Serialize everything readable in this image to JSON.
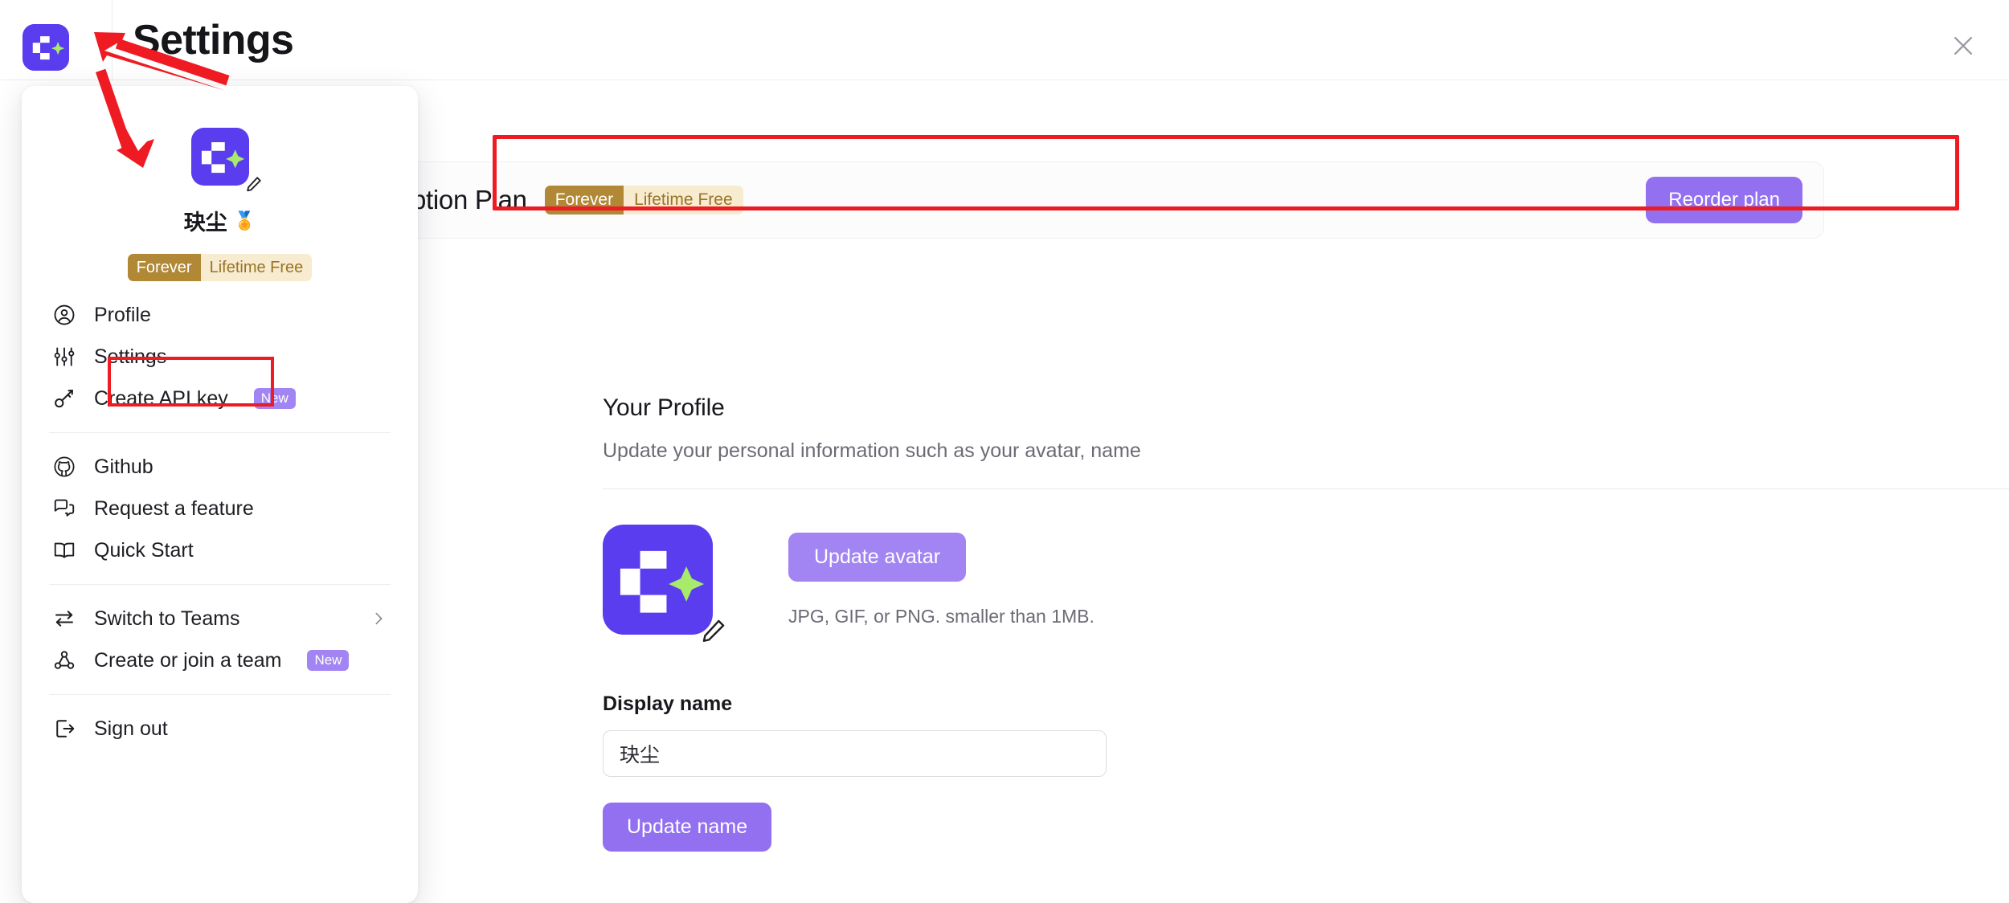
{
  "header": {
    "title": "Settings",
    "logo_icon": "app-logo-icon",
    "close_icon": "close-icon"
  },
  "subscription": {
    "title": "Subscription Plan",
    "plan_tag_left": "Forever",
    "plan_tag_right": "Lifetime Free",
    "reorder_label": "Reorder plan",
    "accent_purple": "#9370f0",
    "gold_dark": "#b08836",
    "gold_light": "#f7ebd0",
    "highlight_color": "#ee1b22"
  },
  "profile": {
    "section_title": "Your Profile",
    "section_subtitle": "Update your personal information such as your avatar, name",
    "update_avatar_label": "Update avatar",
    "avatar_hint": "JPG, GIF, or PNG. smaller than 1MB.",
    "display_name_label": "Display name",
    "display_name_value": "玦尘",
    "display_name_placeholder": "Display name",
    "update_name_label": "Update name"
  },
  "sidebar": {
    "username": "玦尘",
    "username_medal": "🏅",
    "plan_tag_left": "Forever",
    "plan_tag_right": "Lifetime Free",
    "groups": [
      {
        "items": [
          {
            "label": "Profile",
            "icon": "user-circle-icon",
            "badge": null,
            "chevron": false
          },
          {
            "label": "Settings",
            "icon": "sliders-icon",
            "badge": null,
            "chevron": false
          },
          {
            "label": "Create API key",
            "icon": "key-icon",
            "badge": "New",
            "chevron": false
          }
        ]
      },
      {
        "items": [
          {
            "label": "Github",
            "icon": "github-icon",
            "badge": null,
            "chevron": false
          },
          {
            "label": "Request a feature",
            "icon": "chat-bubbles-icon",
            "badge": null,
            "chevron": false
          },
          {
            "label": "Quick Start",
            "icon": "open-book-icon",
            "badge": null,
            "chevron": false
          }
        ]
      },
      {
        "items": [
          {
            "label": "Switch to Teams",
            "icon": "swap-arrows-icon",
            "badge": null,
            "chevron": true
          },
          {
            "label": "Create or join a team",
            "icon": "team-network-icon",
            "badge": "New",
            "chevron": false
          }
        ]
      },
      {
        "items": [
          {
            "label": "Sign out",
            "icon": "sign-out-icon",
            "badge": null,
            "chevron": false
          }
        ]
      }
    ]
  }
}
